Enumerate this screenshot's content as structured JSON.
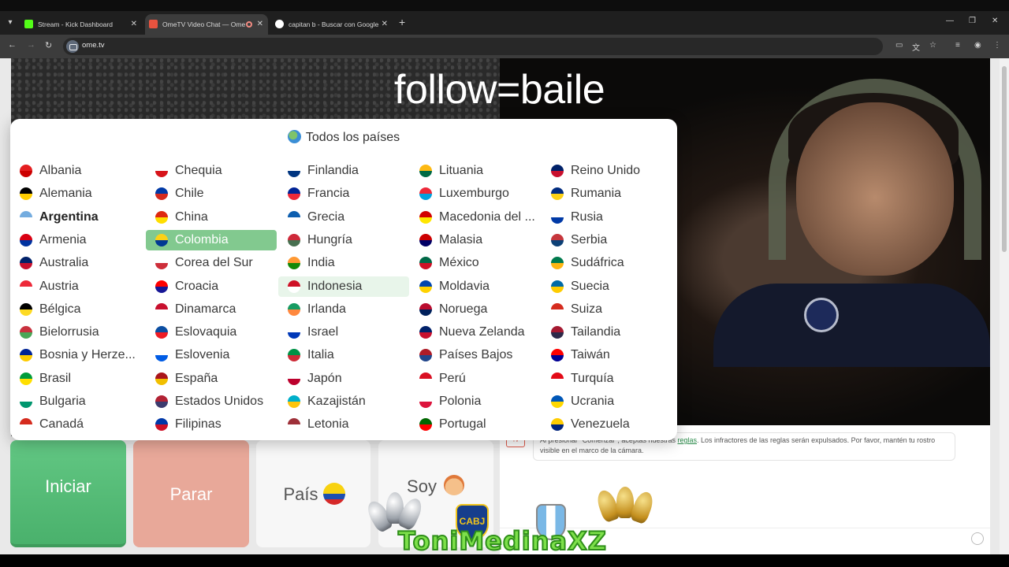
{
  "browser": {
    "tabs": [
      {
        "title": "Stream - Kick Dashboard",
        "favicon_color": "#53fc18"
      },
      {
        "title": "OmeTV Video Chat — Ome",
        "favicon_color": "#e9533f"
      },
      {
        "title": "capitan b - Buscar con Google",
        "favicon_color": "#ffffff"
      }
    ],
    "url": "ome.tv"
  },
  "overlay_text": "follow=baile",
  "country_panel": {
    "title": "Todos los países",
    "selected": "Colombia",
    "hovered": "Indonesia",
    "bold": "Argentina",
    "columns": [
      [
        "Albania",
        "Alemania",
        "Argentina",
        "Armenia",
        "Australia",
        "Austria",
        "Bélgica",
        "Bielorrusia",
        "Bosnia y Herze...",
        "Brasil",
        "Bulgaria",
        "Canadá"
      ],
      [
        "Chequia",
        "Chile",
        "China",
        "Colombia",
        "Corea del Sur",
        "Croacia",
        "Dinamarca",
        "Eslovaquia",
        "Eslovenia",
        "España",
        "Estados Unidos",
        "Filipinas"
      ],
      [
        "Finlandia",
        "Francia",
        "Grecia",
        "Hungría",
        "India",
        "Indonesia",
        "Irlanda",
        "Israel",
        "Italia",
        "Japón",
        "Kazajistán",
        "Letonia"
      ],
      [
        "Lituania",
        "Luxemburgo",
        "Macedonia del ...",
        "Malasia",
        "México",
        "Moldavia",
        "Noruega",
        "Nueva Zelanda",
        "Países Bajos",
        "Perú",
        "Polonia",
        "Portugal"
      ],
      [
        "Reino Unido",
        "Rumania",
        "Rusia",
        "Serbia",
        "Sudáfrica",
        "Suecia",
        "Suiza",
        "Tailandia",
        "Taiwán",
        "Turquía",
        "Ucrania",
        "Venezuela"
      ]
    ],
    "flag_colors": [
      [
        [
          "#e41e20",
          "#c00"
        ],
        [
          "#000",
          "#ffce00"
        ],
        [
          "#74acdf",
          "#fff"
        ],
        [
          "#d90012",
          "#0033a0"
        ],
        [
          "#012169",
          "#c8102e"
        ],
        [
          "#ed2939",
          "#fff"
        ],
        [
          "#000",
          "#fdda24"
        ],
        [
          "#c8313e",
          "#4aa657"
        ],
        [
          "#002395",
          "#fecb00"
        ],
        [
          "#009c3b",
          "#ffdf00"
        ],
        [
          "#fff",
          "#00966e"
        ],
        [
          "#d52b1e",
          "#fff"
        ]
      ],
      [
        [
          "#fff",
          "#d7141a"
        ],
        [
          "#0039a6",
          "#d52b1e"
        ],
        [
          "#de2910",
          "#ffde00"
        ],
        [
          "#fcd116",
          "#003893"
        ],
        [
          "#fff",
          "#cd2e3a"
        ],
        [
          "#ff0000",
          "#171796"
        ],
        [
          "#c8102e",
          "#fff"
        ],
        [
          "#0b4ea2",
          "#ee1c25"
        ],
        [
          "#fff",
          "#005ce5"
        ],
        [
          "#aa151b",
          "#f1bf00"
        ],
        [
          "#b22234",
          "#3c3b6e"
        ],
        [
          "#0038a8",
          "#ce1126"
        ]
      ],
      [
        [
          "#fff",
          "#003580"
        ],
        [
          "#002395",
          "#ed2939"
        ],
        [
          "#0d5eaf",
          "#fff"
        ],
        [
          "#ce2939",
          "#477050"
        ],
        [
          "#ff9933",
          "#138808"
        ],
        [
          "#ce1126",
          "#fff"
        ],
        [
          "#169b62",
          "#ff883e"
        ],
        [
          "#fff",
          "#0038b8"
        ],
        [
          "#009246",
          "#ce2b37"
        ],
        [
          "#fff",
          "#bc002d"
        ],
        [
          "#00afca",
          "#fec50c"
        ],
        [
          "#9e3039",
          "#fff"
        ]
      ],
      [
        [
          "#fdb913",
          "#006a44"
        ],
        [
          "#ed2939",
          "#00a1de"
        ],
        [
          "#d20000",
          "#ffe600"
        ],
        [
          "#cc0001",
          "#010066"
        ],
        [
          "#006847",
          "#ce1126"
        ],
        [
          "#0046ae",
          "#ffd200"
        ],
        [
          "#ba0c2f",
          "#00205b"
        ],
        [
          "#012169",
          "#c8102e"
        ],
        [
          "#ae1c28",
          "#21468b"
        ],
        [
          "#d91023",
          "#fff"
        ],
        [
          "#fff",
          "#dc143c"
        ],
        [
          "#006600",
          "#ff0000"
        ]
      ],
      [
        [
          "#012169",
          "#c8102e"
        ],
        [
          "#002b7f",
          "#fcd116"
        ],
        [
          "#fff",
          "#0039a6"
        ],
        [
          "#c6363c",
          "#0c4076"
        ],
        [
          "#007a4d",
          "#ffb612"
        ],
        [
          "#006aa7",
          "#fecc00"
        ],
        [
          "#d52b1e",
          "#fff"
        ],
        [
          "#a51931",
          "#2d2a4a"
        ],
        [
          "#fe0000",
          "#000095"
        ],
        [
          "#e30a17",
          "#fff"
        ],
        [
          "#0057b7",
          "#ffd700"
        ],
        [
          "#ffcc00",
          "#00247d"
        ]
      ]
    ]
  },
  "controls": {
    "start_label": "Iniciar",
    "stop_label": "Parar",
    "country_label": "País",
    "gender_label": "Soy"
  },
  "chat": {
    "system_message_pre": "Al presionar \"Comenzar\", aceptas nuestras ",
    "system_message_link": "reglas",
    "system_message_post": ". Los infractores de las reglas serán expulsados. Por favor, mantén tu rostro visible en el marco de la cámara.",
    "tv_badge": "TV"
  },
  "watermark": "ToniMedinaXZ",
  "cabj_text": "CABJ"
}
